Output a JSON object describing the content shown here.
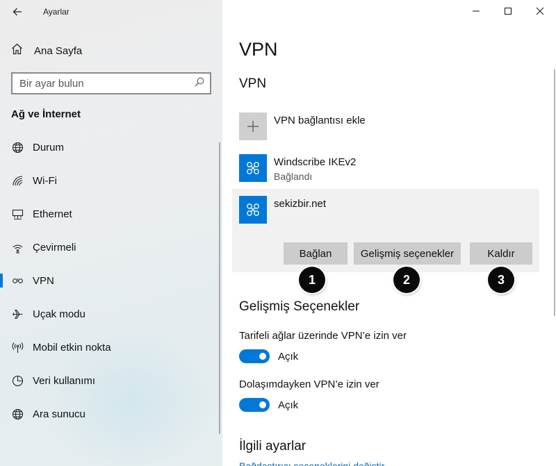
{
  "window": {
    "title": "Ayarlar",
    "controls": [
      "minimize",
      "maximize",
      "close"
    ]
  },
  "sidebar": {
    "home_label": "Ana Sayfa",
    "search_placeholder": "Bir ayar bulun",
    "section_title": "Ağ ve İnternet",
    "items": [
      {
        "label": "Durum",
        "icon": "globe-icon"
      },
      {
        "label": "Wi-Fi",
        "icon": "wifi-icon"
      },
      {
        "label": "Ethernet",
        "icon": "ethernet-icon"
      },
      {
        "label": "Çevirmeli",
        "icon": "dialup-icon"
      },
      {
        "label": "VPN",
        "icon": "vpn-icon",
        "active": true
      },
      {
        "label": "Uçak modu",
        "icon": "airplane-icon"
      },
      {
        "label": "Mobil etkin nokta",
        "icon": "hotspot-icon"
      },
      {
        "label": "Veri kullanımı",
        "icon": "pie-chart-icon"
      },
      {
        "label": "Ara sunucu",
        "icon": "globe-icon"
      }
    ]
  },
  "main": {
    "page_title": "VPN",
    "section_title": "VPN",
    "add_label": "VPN bağlantısı ekle",
    "connections": [
      {
        "name": "Windscribe IKEv2",
        "status": "Bağlandı"
      },
      {
        "name": "sekizbir.net",
        "status": ""
      }
    ],
    "buttons": {
      "connect": "Bağlan",
      "advanced": "Gelişmiş seçenekler",
      "remove": "Kaldır"
    },
    "annotations": [
      "1",
      "2",
      "3"
    ],
    "advanced_title": "Gelişmiş Seçenekler",
    "options": [
      {
        "label": "Tarifeli ağlar üzerinde VPN’e izin ver",
        "state": "Açık"
      },
      {
        "label": "Dolaşımdayken VPN’e izin ver",
        "state": "Açık"
      }
    ],
    "related_title": "İlgili ayarlar",
    "related_link": "Bağdaştırıcı seçeneklerini değiştir"
  },
  "colors": {
    "accent": "#0078d7",
    "annotation_badge": "#0a0a0a",
    "selected_bg": "#f1f1f1",
    "button_bg": "#cccccc",
    "link": "#0066b4"
  }
}
